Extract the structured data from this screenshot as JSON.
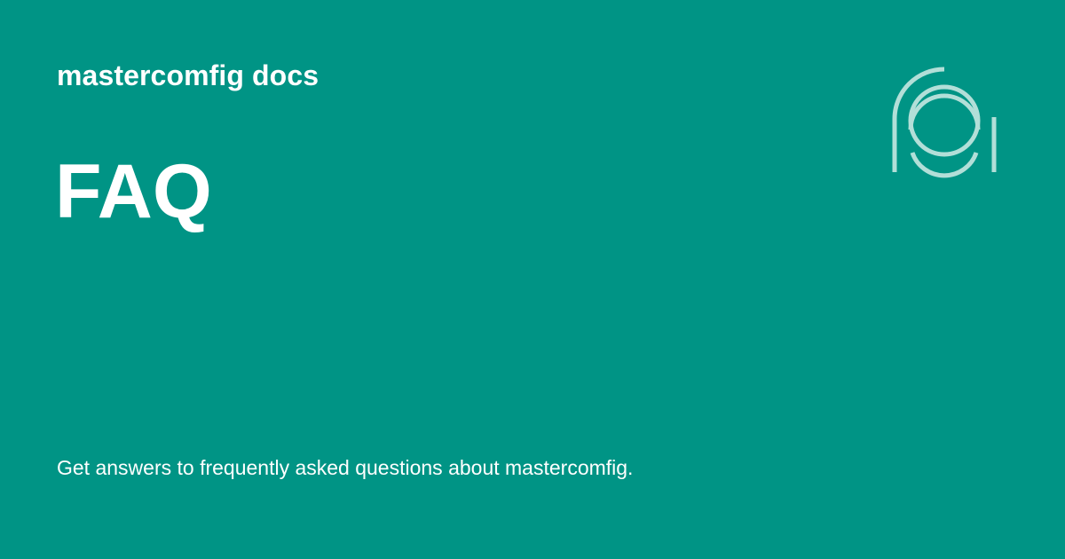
{
  "colors": {
    "background": "#009485",
    "text": "#ffffff",
    "logo_stroke": "#b2dfd8"
  },
  "header": {
    "site_name": "mastercomfig docs"
  },
  "main": {
    "title": "FAQ",
    "description": "Get answers to frequently asked questions about mastercomfig."
  },
  "logo": {
    "icon": "mastercomfig-logo-icon"
  }
}
